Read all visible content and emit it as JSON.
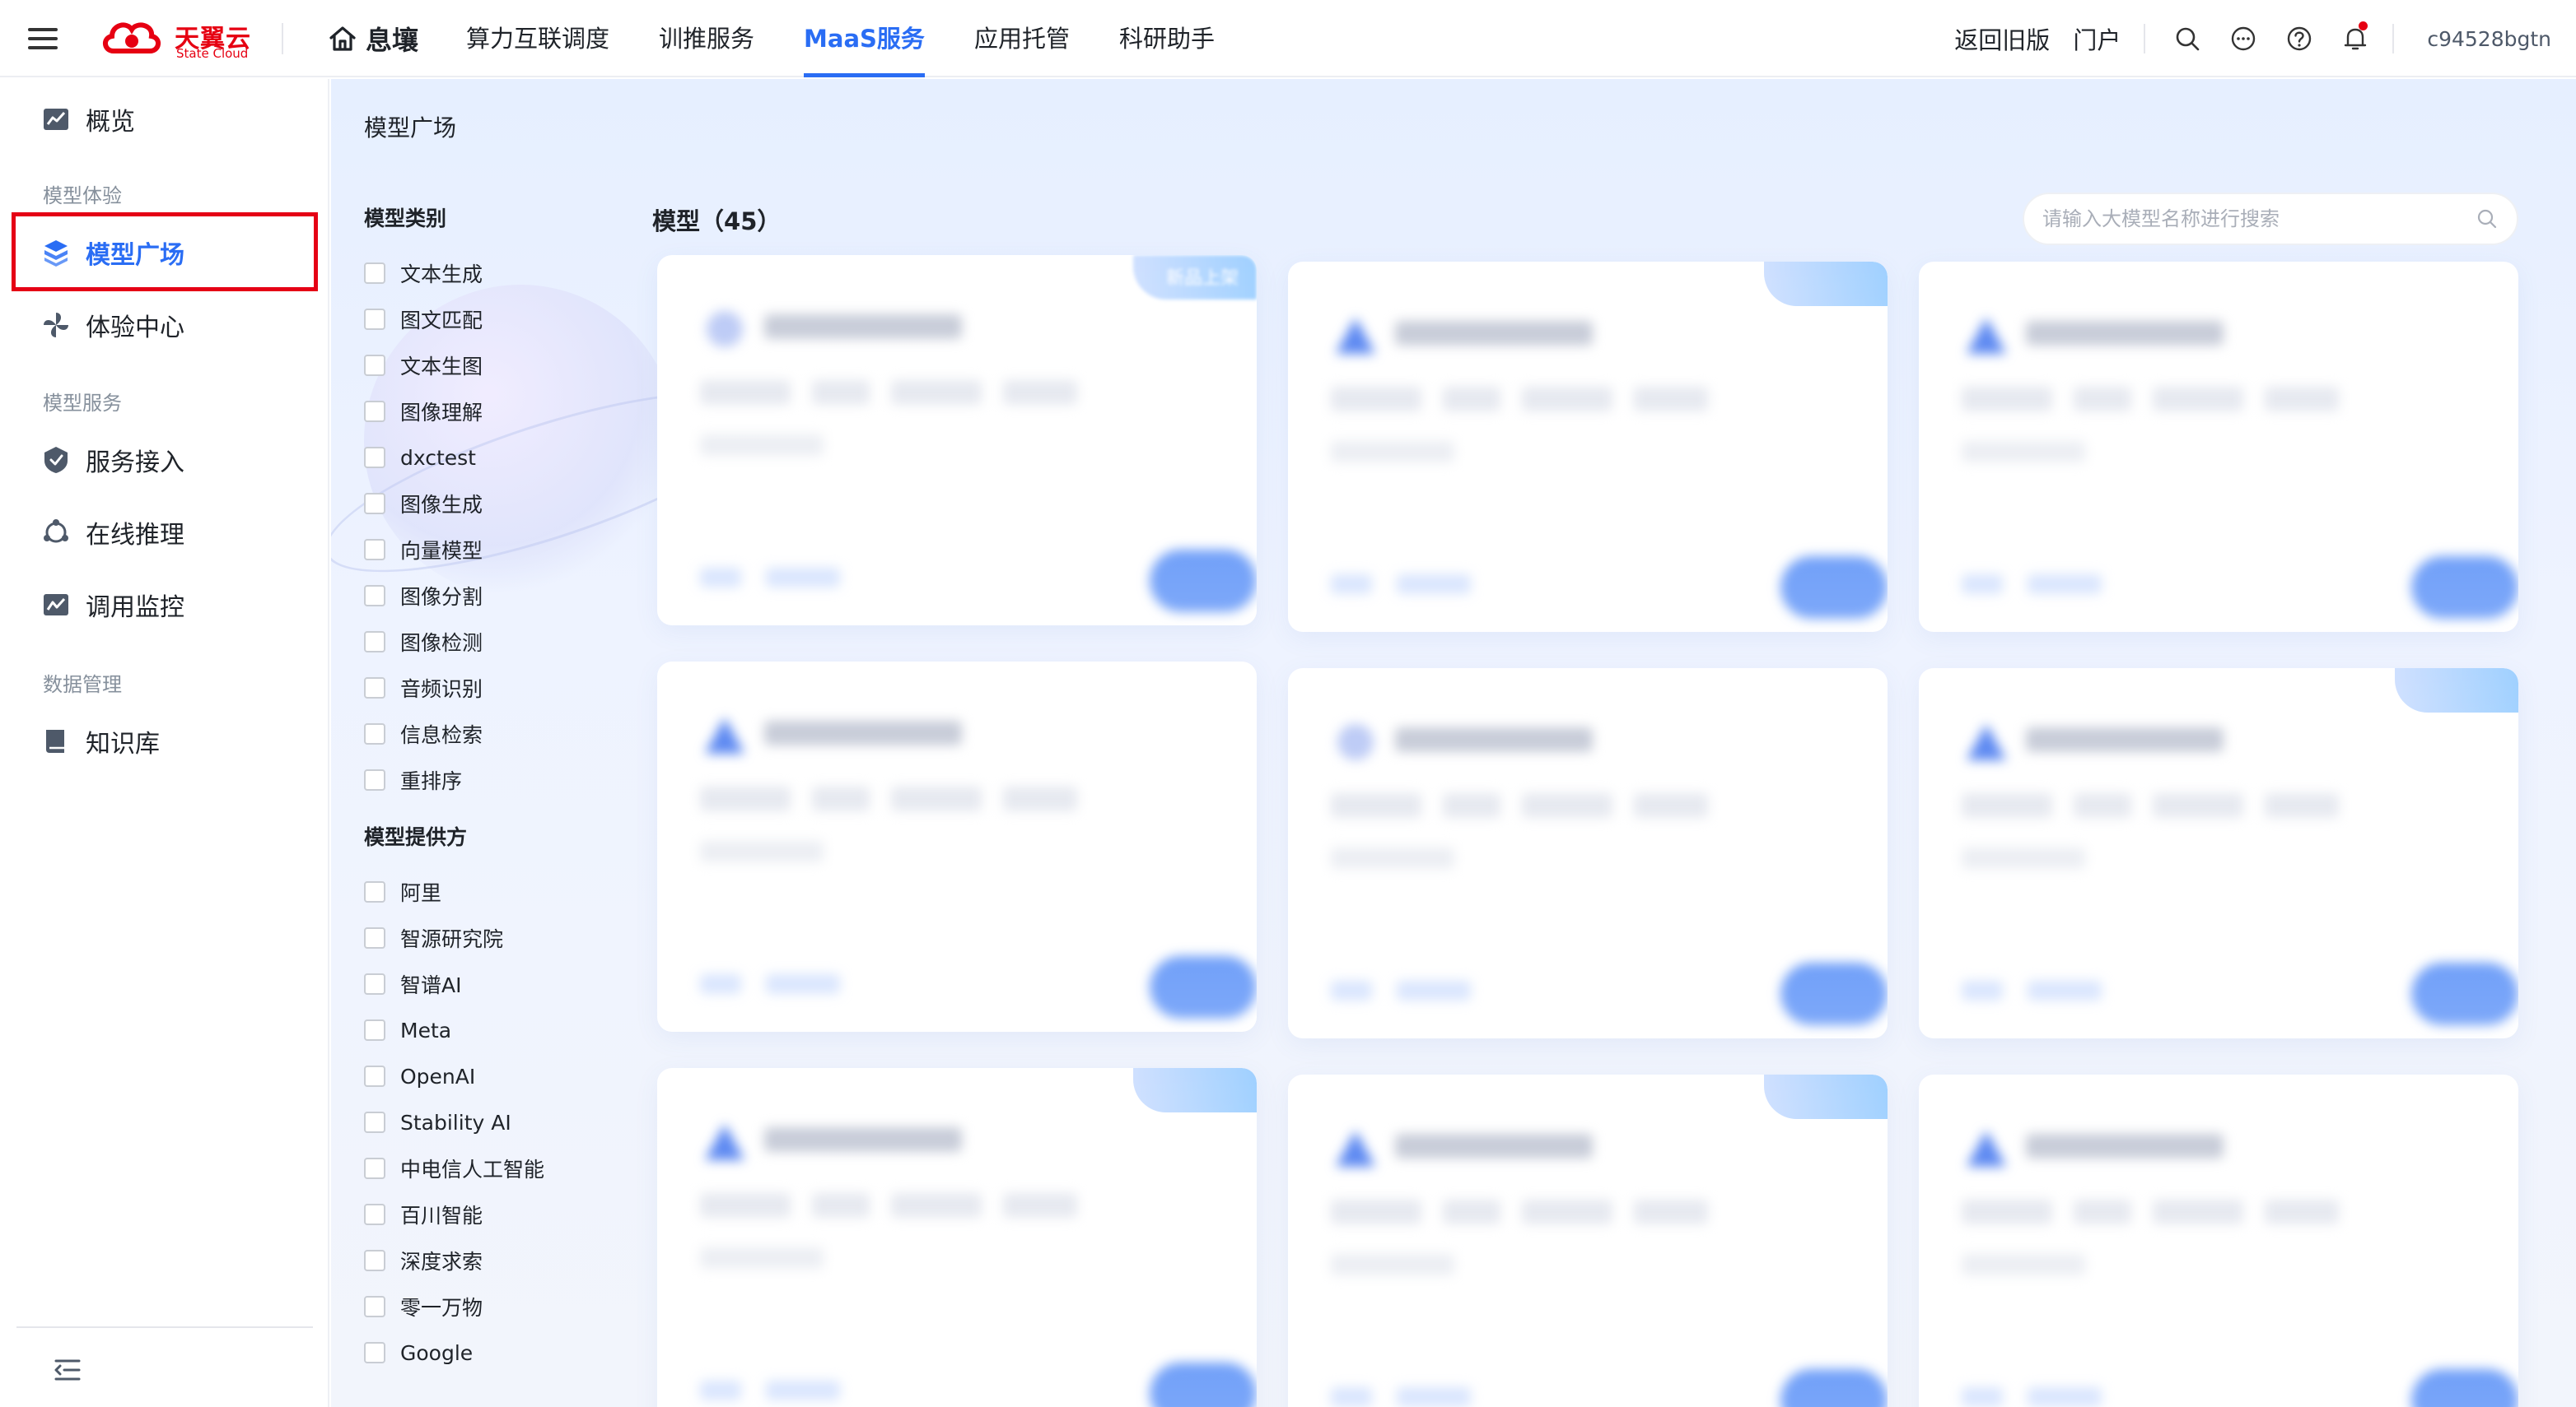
{
  "header": {
    "brand_cn": "天翼云",
    "brand_en": "State Cloud",
    "home_label": "息壤",
    "nav": [
      {
        "label": "算力互联调度"
      },
      {
        "label": "训推服务"
      },
      {
        "label": "MaaS服务",
        "active": true
      },
      {
        "label": "应用托管"
      },
      {
        "label": "科研助手"
      }
    ],
    "back_old_label": "返回旧版",
    "portal_label": "门户",
    "user": "c94528bgtn",
    "colors": {
      "brand_red": "#e60012",
      "accent_blue": "#2a6df4"
    }
  },
  "sidebar": {
    "overview": "概览",
    "group_experience": "模型体验",
    "model_square": "模型广场",
    "experience_center": "体验中心",
    "group_service": "模型服务",
    "service_access": "服务接入",
    "online_inference": "在线推理",
    "call_monitor": "调用监控",
    "group_data": "数据管理",
    "knowledge_base": "知识库",
    "icons": [
      "chart-icon",
      "cube-icon",
      "pinwheel-icon",
      "shield-icon",
      "cycle-icon",
      "monitor-icon",
      "book-icon",
      "collapse-icon"
    ]
  },
  "main": {
    "page_title": "模型广场",
    "category_title": "模型类别",
    "categories": [
      "文本生成",
      "图文匹配",
      "文本生图",
      "图像理解",
      "dxctest",
      "图像生成",
      "向量模型",
      "图像分割",
      "图像检测",
      "音频识别",
      "信息检索",
      "重排序"
    ],
    "provider_title": "模型提供方",
    "providers": [
      "阿里",
      "智源研究院",
      "智谱AI",
      "Meta",
      "OpenAI",
      "Stability AI",
      "中电信人工智能",
      "百川智能",
      "深度求索",
      "零一万物",
      "Google"
    ],
    "models_label": "模型",
    "models_count": "（45）",
    "search_placeholder": "请输入大模型名称进行搜索",
    "first_card_badge": "新品上架",
    "cards": [
      {
        "icon": "sparkle-icon",
        "badge": true
      },
      {
        "icon": "triangle-icon",
        "badge": true
      },
      {
        "icon": "triangle-icon",
        "badge": false
      },
      {
        "icon": "triangle-icon",
        "badge": false
      },
      {
        "icon": "sparkle-icon",
        "badge": false
      },
      {
        "icon": "triangle-icon",
        "badge": true
      },
      {
        "icon": "triangle-icon",
        "badge": true
      },
      {
        "icon": "triangle-icon",
        "badge": true
      },
      {
        "icon": "triangle-icon",
        "badge": false
      }
    ]
  }
}
